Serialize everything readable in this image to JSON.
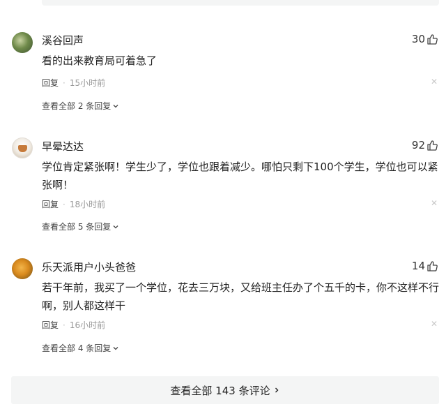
{
  "comments": [
    {
      "username": "溪谷回声",
      "likes": "30",
      "text": "看的出来教育局可着急了",
      "reply_label": "回复",
      "time": "15小时前",
      "view_replies": "查看全部 2 条回复"
    },
    {
      "username": "早晕达达",
      "likes": "92",
      "text": "学位肯定紧张啊！学生少了，学位也跟着减少。哪怕只剩下100个学生，学位也可以紧张啊！",
      "reply_label": "回复",
      "time": "18小时前",
      "view_replies": "查看全部 5 条回复"
    },
    {
      "username": "乐天派用户小头爸爸",
      "likes": "14",
      "text": "若干年前，我买了一个学位，花去三万块，又给班主任办了个五千的卡，你不这样不行啊，别人都这样干",
      "reply_label": "回复",
      "time": "16小时前",
      "view_replies": "查看全部 4 条回复"
    }
  ],
  "dot": "·",
  "close_glyph": "✕",
  "view_all_comments": "查看全部 143 条评论",
  "icons": {
    "like": "thumbs-up-icon",
    "dismiss": "close-icon",
    "expand": "chevron-down-icon",
    "more": "chevron-right-icon"
  }
}
